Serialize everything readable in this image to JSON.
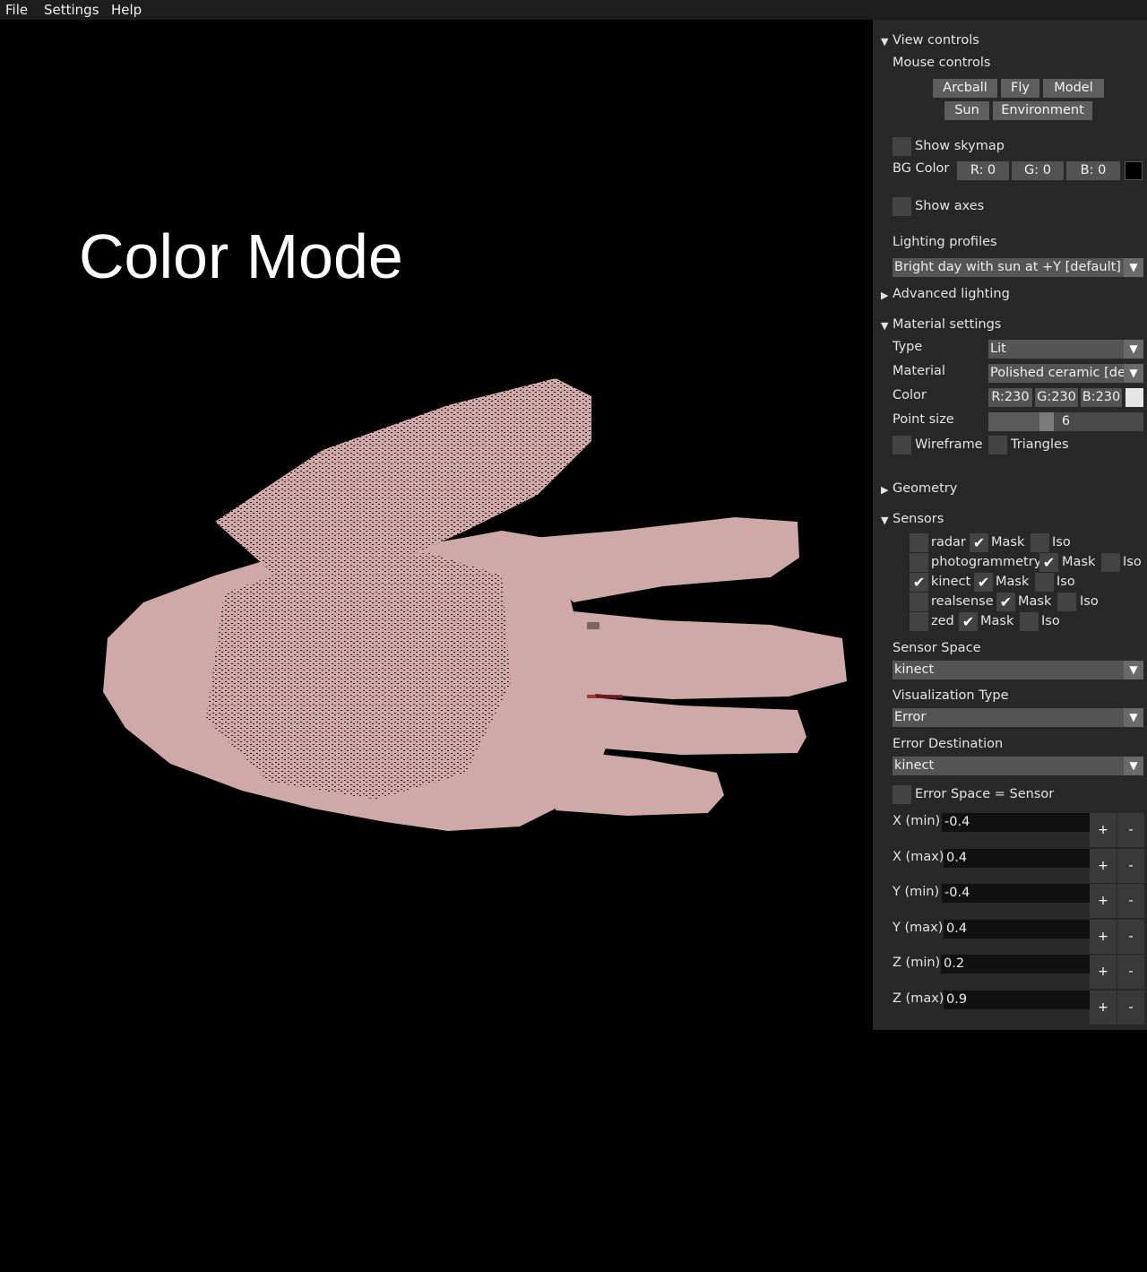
{
  "menu": {
    "file": "File",
    "settings": "Settings",
    "help": "Help"
  },
  "viewport": {
    "title": "Color Mode"
  },
  "view_controls": {
    "header": "View controls",
    "mouse_controls_label": "Mouse controls",
    "buttons": {
      "arcball": "Arcball",
      "fly": "Fly",
      "model": "Model",
      "sun": "Sun",
      "environment": "Environment"
    },
    "show_skymap": "Show skymap",
    "bg_color_label": "BG Color",
    "bg_r": "R: 0",
    "bg_g": "G: 0",
    "bg_b": "B: 0",
    "bg_swatch_color": "#000000",
    "show_axes": "Show axes",
    "lighting_profiles_label": "Lighting profiles",
    "lighting_profile_value": "Bright day with sun at +Y [default]"
  },
  "advanced_lighting": {
    "header": "Advanced lighting"
  },
  "material_settings": {
    "header": "Material settings",
    "type_label": "Type",
    "type_value": "Lit",
    "material_label": "Material",
    "material_value": "Polished ceramic [default]",
    "color_label": "Color",
    "color_r": "R:230",
    "color_g": "G:230",
    "color_b": "B:230",
    "color_swatch": "#e6e6e6",
    "point_size_label": "Point size",
    "point_size_value": "6",
    "point_size_fraction": 0.36,
    "wireframe": "Wireframe",
    "triangles": "Triangles"
  },
  "geometry": {
    "header": "Geometry"
  },
  "sensors": {
    "header": "Sensors",
    "rows": [
      {
        "name": "radar",
        "checked": false,
        "mask_label": "Mask",
        "mask": true,
        "iso_label": "Iso",
        "iso": false
      },
      {
        "name": "photogrammetry",
        "checked": false,
        "mask_label": "Mask",
        "mask": true,
        "iso_label": "Iso",
        "iso": false
      },
      {
        "name": "kinect",
        "checked": true,
        "mask_label": "Mask",
        "mask": true,
        "iso_label": "Iso",
        "iso": false
      },
      {
        "name": "realsense",
        "checked": false,
        "mask_label": "Mask",
        "mask": true,
        "iso_label": "Iso",
        "iso": false
      },
      {
        "name": "zed",
        "checked": false,
        "mask_label": "Mask",
        "mask": true,
        "iso_label": "Iso",
        "iso": false
      }
    ],
    "sensor_space_label": "Sensor Space",
    "sensor_space_value": "kinect",
    "visualization_type_label": "Visualization Type",
    "visualization_type_value": "Error",
    "error_destination_label": "Error Destination",
    "error_destination_value": "kinect",
    "error_space_sensor": "Error Space = Sensor",
    "ranges": [
      {
        "label": "X (min)",
        "value": "-0.4"
      },
      {
        "label": "X (max)",
        "value": "0.4"
      },
      {
        "label": "Y (min)",
        "value": "-0.4"
      },
      {
        "label": "Y (max)",
        "value": "0.4"
      },
      {
        "label": "Z (min)",
        "value": "0.2"
      },
      {
        "label": "Z (max)",
        "value": "0.9"
      }
    ],
    "plus": "+",
    "minus": "-"
  },
  "icons": {
    "expanded": "▼",
    "collapsed": "▶",
    "dropdown": "▼",
    "check": "✔"
  }
}
